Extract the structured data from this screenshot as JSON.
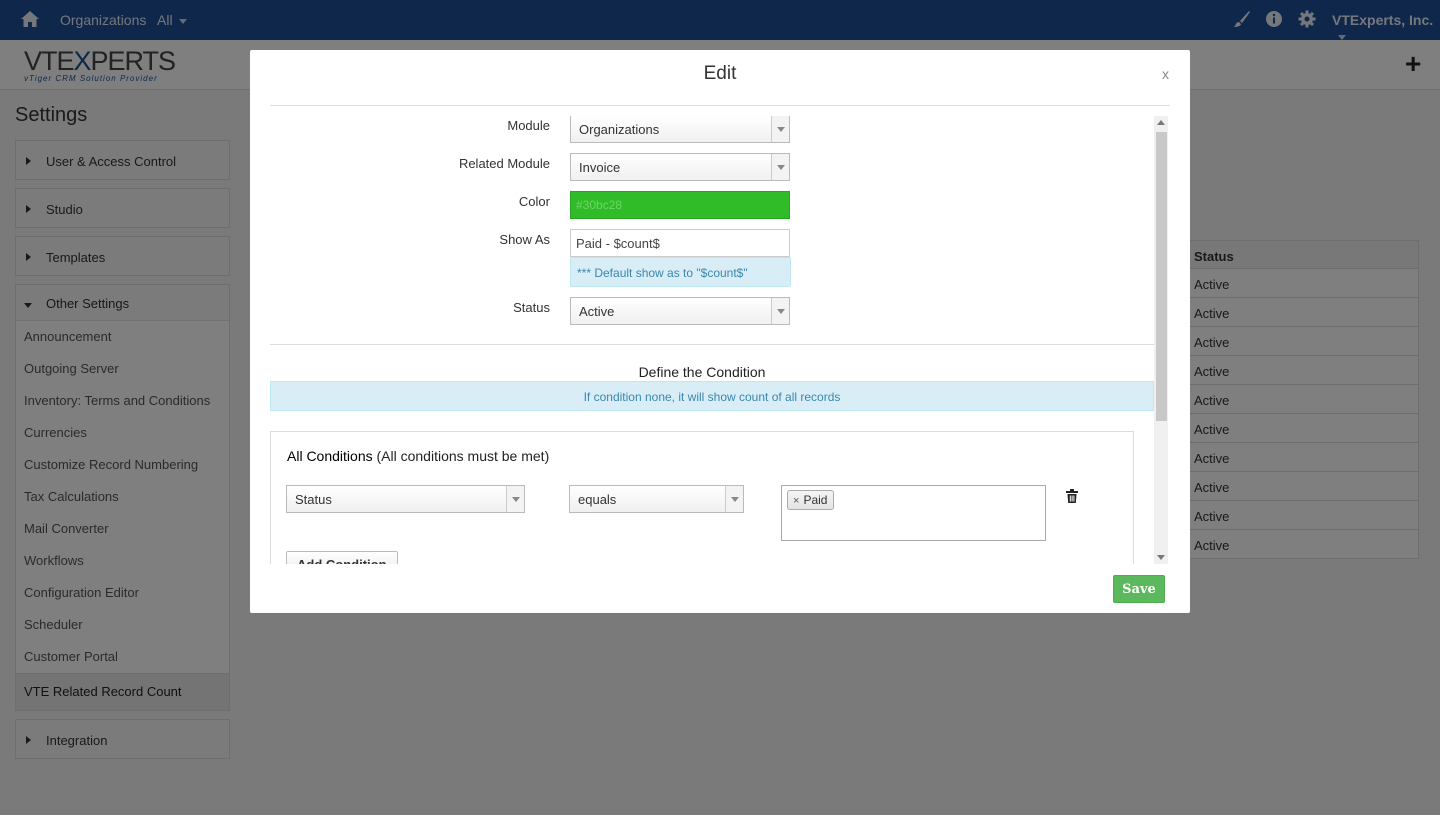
{
  "topbar": {
    "breadcrumb_module": "Organizations",
    "breadcrumb_filter": "All",
    "company": "VTExperts, Inc."
  },
  "logo": {
    "text_a": "VTE",
    "text_b": "X",
    "text_c": "PERTS",
    "tagline": "vTiger CRM Solution Provider"
  },
  "settings": {
    "title": "Settings",
    "sections": {
      "user_access": "User & Access Control",
      "studio": "Studio",
      "templates": "Templates",
      "other": "Other Settings",
      "integration": "Integration"
    },
    "other_items": [
      "Announcement",
      "Outgoing Server",
      "Inventory: Terms and Conditions",
      "Currencies",
      "Customize Record Numbering",
      "Tax Calculations",
      "Mail Converter",
      "Workflows",
      "Configuration Editor",
      "Scheduler",
      "Customer Portal"
    ],
    "active_item": "VTE Related Record Count"
  },
  "bg_table": {
    "header": "Status",
    "rows": [
      "Active",
      "Active",
      "Active",
      "Active",
      "Active",
      "Active",
      "Active",
      "Active",
      "Active",
      "Active"
    ]
  },
  "modal": {
    "title": "Edit",
    "close": "x",
    "fields": {
      "module_label": "Module",
      "module_value": "Organizations",
      "related_label": "Related Module",
      "related_value": "Invoice",
      "color_label": "Color",
      "color_value": "#30bc28",
      "color_hex": "#30bc28",
      "showas_label": "Show As",
      "showas_value": "Paid - $count$",
      "showas_hint": "*** Default show as to \"$count$\"",
      "status_label": "Status",
      "status_value": "Active"
    },
    "condition": {
      "title": "Define the Condition",
      "info": "If condition none, it will show count of all records",
      "all_bold": "All Conditions",
      "all_note": "(All conditions must be met)",
      "field": "Status",
      "operator": "equals",
      "tag_remove": "×",
      "tag": "Paid",
      "add_button": "Add Condition"
    },
    "save": "Save"
  }
}
